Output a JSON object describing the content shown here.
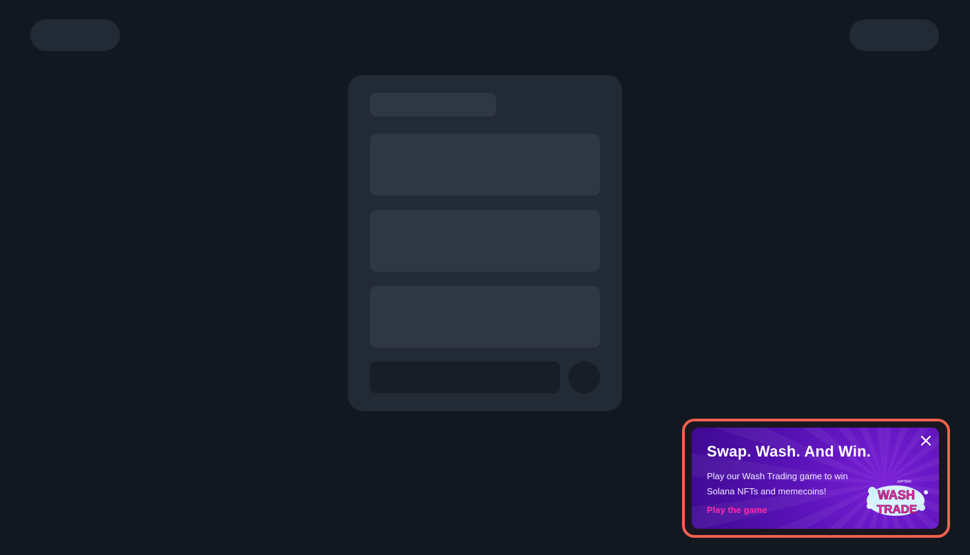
{
  "promo": {
    "title": "Swap. Wash. And Win.",
    "body_line1": "Play our Wash Trading game to win",
    "body_line2": "Solana NFTs and memecoins!",
    "link_label": "Play the game",
    "close_icon": "close-icon",
    "logo_text_top": "WASH",
    "logo_text_bottom": "TRADE",
    "logo_brand": "JUPITER",
    "accent_color": "#ff2aa8",
    "highlight_color": "#f4614e"
  }
}
